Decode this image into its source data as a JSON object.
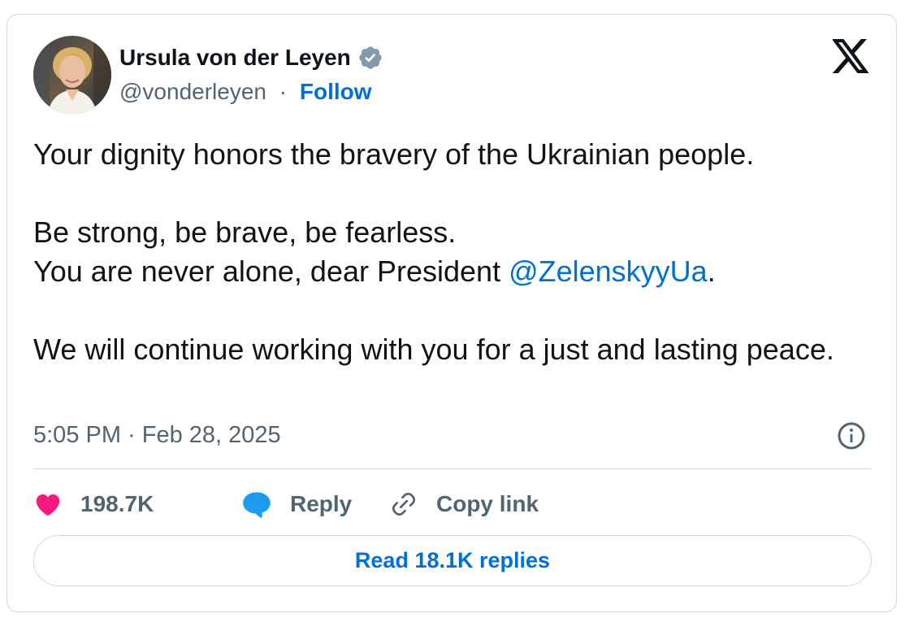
{
  "author": {
    "name": "Ursula von der Leyen",
    "handle": "@vonderleyen",
    "separator": "·",
    "follow_label": "Follow",
    "verified": true
  },
  "icons": {
    "verified": "verified-badge-icon",
    "platform": "x-logo-icon",
    "info": "info-icon",
    "like": "heart-icon",
    "reply": "speech-bubble-icon",
    "copy": "link-icon"
  },
  "tweet": {
    "line1": "Your dignity honors the bravery of the Ukrainian people.",
    "line2": "Be strong, be brave, be fearless.",
    "line3_prefix": "You are never alone, dear President ",
    "line3_mention": "@ZelenskyyUa",
    "line3_suffix": ".",
    "line4": "We will continue working with you for a just and lasting peace."
  },
  "meta": {
    "timestamp": "5:05 PM · Feb 28, 2025"
  },
  "actions": {
    "likes": "198.7K",
    "reply_label": "Reply",
    "copy_label": "Copy link"
  },
  "replies": {
    "label": "Read 18.1K replies"
  },
  "colors": {
    "link": "#006fd6",
    "like": "#f91880",
    "reply_icon": "#1d9bf0",
    "secondary_text": "#536471",
    "border": "#cfd9de",
    "primary_text": "#0f1419"
  }
}
